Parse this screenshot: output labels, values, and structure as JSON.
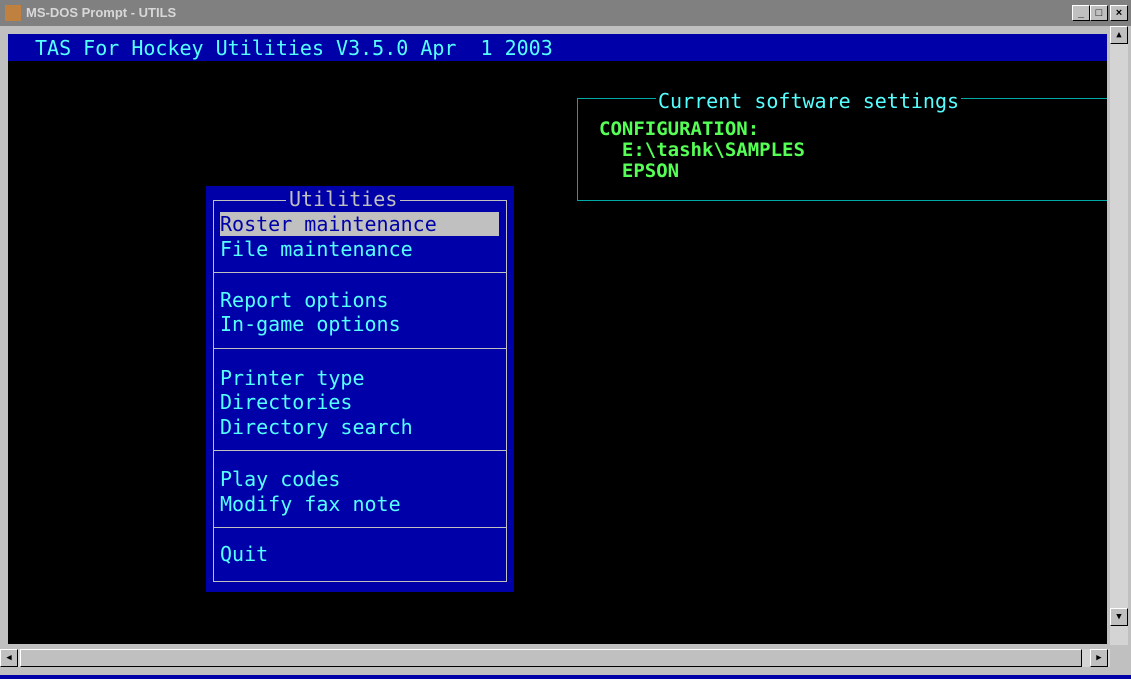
{
  "window": {
    "title": "MS-DOS Prompt - UTILS",
    "minimize": "_",
    "maximize": "□",
    "close": "×"
  },
  "console": {
    "header": "TAS For Hockey Utilities V3.5.0 Apr  1 2003",
    "settings": {
      "title": "Current software settings",
      "lines": [
        "CONFIGURATION:",
        "  E:\\tashk\\SAMPLES",
        "  EPSON"
      ]
    },
    "menu": {
      "title": "Utilities",
      "groups": [
        [
          "Roster maintenance",
          "File maintenance"
        ],
        [
          "Report options",
          "In-game options"
        ],
        [
          "Printer type",
          "Directories",
          "Directory search"
        ],
        [
          "Play codes",
          "Modify fax note"
        ],
        [
          "Quit"
        ]
      ],
      "selected": "Roster maintenance"
    }
  },
  "scrollbars": {
    "up": "▲",
    "down": "▼",
    "left": "◀",
    "right": "▶"
  }
}
